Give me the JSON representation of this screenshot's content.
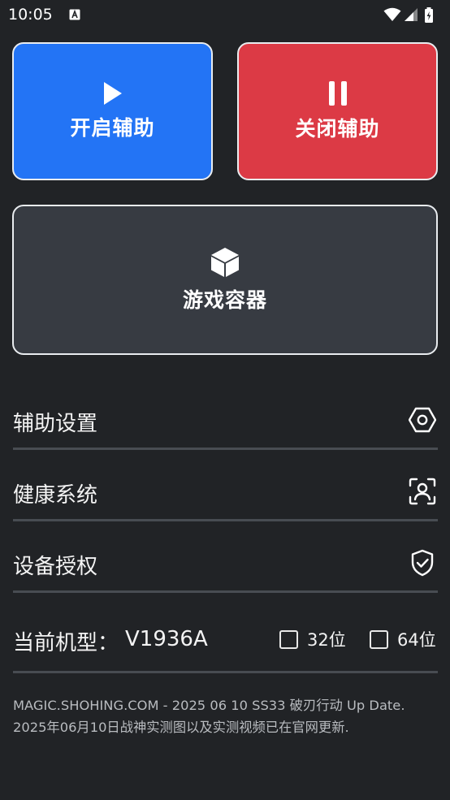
{
  "status_bar": {
    "time": "10:05",
    "notification_icon": "font-a-icon",
    "icons": [
      "wifi-icon",
      "cell-signal-icon",
      "battery-charging-icon"
    ]
  },
  "actions": {
    "start": {
      "label": "开启辅助",
      "icon": "play-icon",
      "color": "#2374f5"
    },
    "stop": {
      "label": "关闭辅助",
      "icon": "pause-icon",
      "color": "#dc3a45"
    },
    "container": {
      "label": "游戏容器",
      "icon": "cube-icon",
      "color": "#373b42"
    }
  },
  "menu": {
    "items": [
      {
        "label": "辅助设置",
        "icon": "settings-hex-icon"
      },
      {
        "label": "健康系统",
        "icon": "face-scan-icon"
      },
      {
        "label": "设备授权",
        "icon": "shield-check-icon"
      }
    ]
  },
  "device": {
    "label": "当前机型：",
    "model": "V1936A",
    "options": [
      {
        "label": "32位",
        "checked": false
      },
      {
        "label": "64位",
        "checked": false
      }
    ]
  },
  "footer": {
    "line1": "MAGIC.SHOHING.COM - 2025 06 10 SS33 破刃行动 Up Date.",
    "line2": "2025年06月10日战神实测图以及实测视频已在官网更新."
  }
}
